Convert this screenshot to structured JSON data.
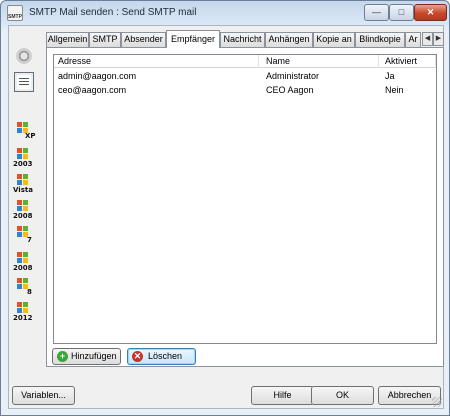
{
  "window": {
    "title": "SMTP Mail senden : Send SMTP mail",
    "app_icon_text": "SMTP",
    "minimize_glyph": "—",
    "maximize_glyph": "□",
    "close_glyph": "✕"
  },
  "iconbar": {
    "items": [
      {
        "name": "winxp",
        "label": "XP"
      },
      {
        "name": "win2003",
        "label": "2003"
      },
      {
        "name": "winvista",
        "label": "Vista"
      },
      {
        "name": "win2008",
        "label": "2008"
      },
      {
        "name": "win7",
        "label": "7"
      },
      {
        "name": "win2008r2",
        "label": "2008"
      },
      {
        "name": "win8",
        "label": "8"
      },
      {
        "name": "win2012",
        "label": "2012"
      }
    ]
  },
  "tabs": {
    "items": [
      "Allgemein",
      "SMTP",
      "Absender",
      "Empfänger",
      "Nachricht",
      "Anhängen",
      "Kopie an",
      "Blindkopie",
      "Ar"
    ],
    "active": "Empfänger",
    "scroll_left": "◀",
    "scroll_right": "▶"
  },
  "list": {
    "columns": [
      "Adresse",
      "Name",
      "Aktiviert"
    ],
    "rows": [
      {
        "address": "admin@aagon.com",
        "name": "Administrator",
        "enabled": "Ja"
      },
      {
        "address": "ceo@aagon.com",
        "name": "CEO Aagon",
        "enabled": "Nein"
      }
    ]
  },
  "actions": {
    "add_label": "Hinzufügen",
    "delete_label": "Löschen",
    "add_icon": "+",
    "delete_icon": "✕"
  },
  "footer": {
    "variables_label": "Variablen...",
    "help_label": "Hilfe",
    "ok_label": "OK",
    "cancel_label": "Abbrechen"
  },
  "colors": {
    "add_icon": "#3aa63a",
    "delete_icon": "#c8322b"
  }
}
